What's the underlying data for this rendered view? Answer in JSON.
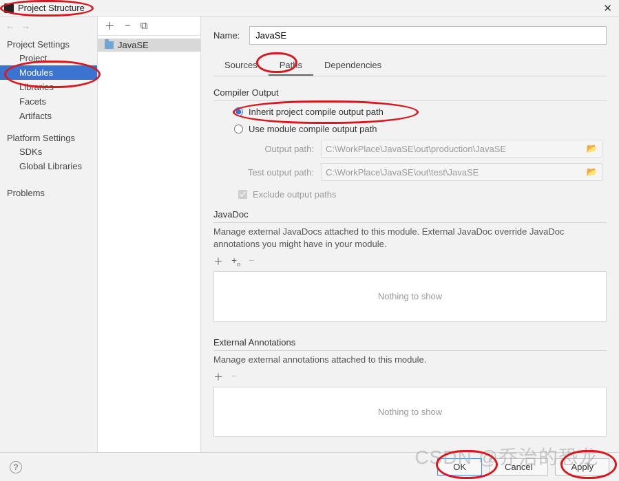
{
  "window": {
    "title": "Project Structure"
  },
  "sidebar": {
    "settings_header": "Project Settings",
    "platform_header": "Platform Settings",
    "items": [
      "Project",
      "Modules",
      "Libraries",
      "Facets",
      "Artifacts"
    ],
    "platform_items": [
      "SDKs",
      "Global Libraries"
    ],
    "problems": "Problems"
  },
  "modules": {
    "items": [
      "JavaSE"
    ]
  },
  "form": {
    "name_label": "Name:",
    "name_value": "JavaSE",
    "tabs": [
      "Sources",
      "Paths",
      "Dependencies"
    ],
    "compiler_output": "Compiler Output",
    "inherit": "Inherit project compile output path",
    "use_module": "Use module compile output path",
    "output_path_label": "Output path:",
    "output_path_value": "C:\\WorkPlace\\JavaSE\\out\\production\\JavaSE",
    "test_output_label": "Test output path:",
    "test_output_value": "C:\\WorkPlace\\JavaSE\\out\\test\\JavaSE",
    "exclude": "Exclude output paths",
    "javadoc_header": "JavaDoc",
    "javadoc_desc": "Manage external JavaDocs attached to this module. External JavaDoc override JavaDoc annotations you might have in your module.",
    "ext_ann_header": "External Annotations",
    "ext_ann_desc": "Manage external annotations attached to this module.",
    "nothing": "Nothing to show"
  },
  "buttons": {
    "ok": "OK",
    "cancel": "Cancel",
    "apply": "Apply"
  }
}
